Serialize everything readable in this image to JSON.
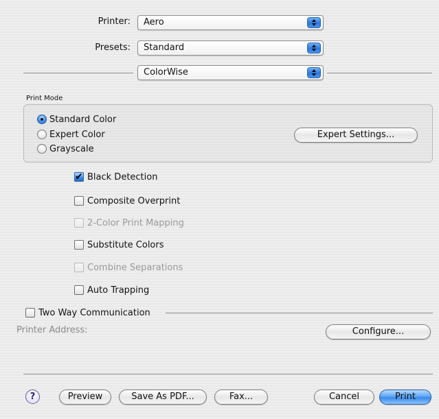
{
  "printer": {
    "label": "Printer:",
    "value": "Aero"
  },
  "presets": {
    "label": "Presets:",
    "value": "Standard"
  },
  "panel": {
    "value": "ColorWise"
  },
  "print_mode": {
    "title": "Print Mode",
    "options": [
      "Standard Color",
      "Expert Color",
      "Grayscale"
    ],
    "selected": "Standard Color",
    "expert_settings_label": "Expert Settings..."
  },
  "options": {
    "black_detection": {
      "label": "Black Detection",
      "checked": true
    },
    "composite_overprint": {
      "label": "Composite Overprint",
      "checked": false
    },
    "two_color_mapping": {
      "label": "2-Color Print Mapping",
      "checked": false,
      "enabled": false
    },
    "substitute_colors": {
      "label": "Substitute Colors",
      "checked": false
    },
    "combine_separations": {
      "label": "Combine Separations",
      "checked": false,
      "enabled": false
    },
    "auto_trapping": {
      "label": "Auto Trapping",
      "checked": false
    }
  },
  "two_way": {
    "label": "Two Way Communication",
    "checked": false,
    "address_label": "Printer Address:",
    "configure_label": "Configure..."
  },
  "footer": {
    "help": "?",
    "preview": "Preview",
    "save_pdf": "Save As PDF...",
    "fax": "Fax...",
    "cancel": "Cancel",
    "print": "Print"
  },
  "colors": {
    "accent": "#3a8aec",
    "disabled_text": "#9a9a9a"
  },
  "check_mark": "✔"
}
